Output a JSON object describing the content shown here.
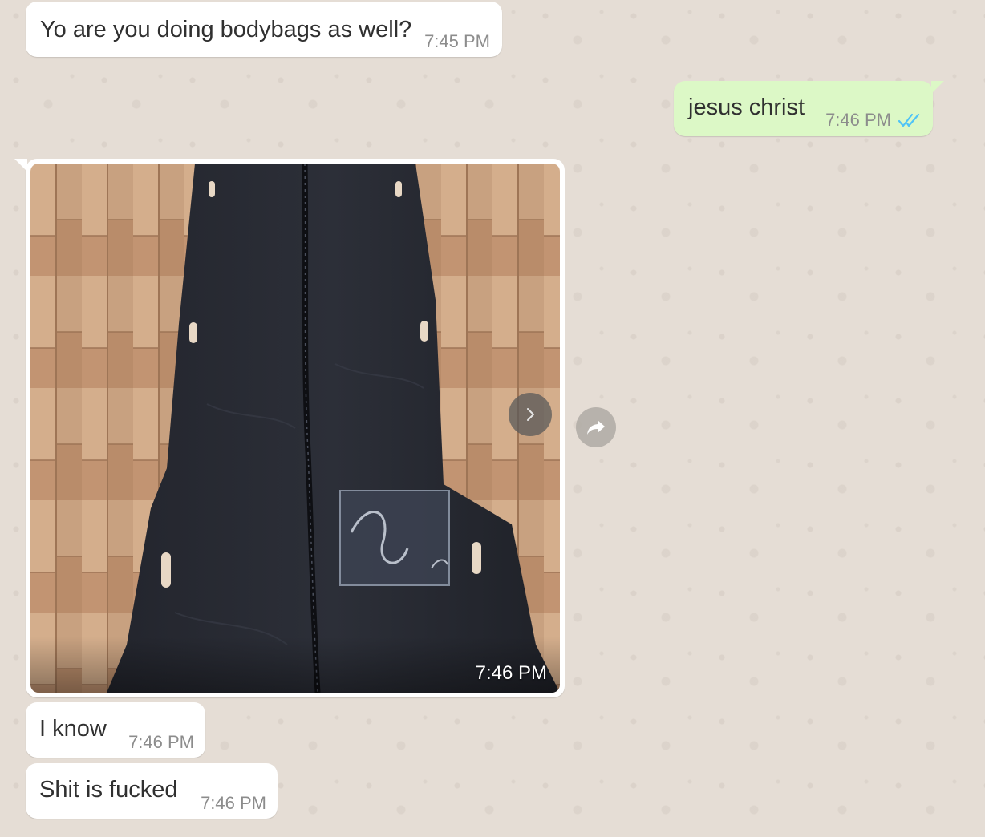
{
  "chat": {
    "messages": [
      {
        "direction": "incoming",
        "type": "text",
        "text": "Yo are you doing bodybags as well?",
        "time": "7:45 PM"
      },
      {
        "direction": "outgoing",
        "type": "text",
        "text": "jesus christ",
        "time": "7:46 PM",
        "status": "read",
        "status_icon": "double-check-icon"
      },
      {
        "direction": "incoming",
        "type": "image",
        "image_icon": "photo-bodybag",
        "time": "7:46 PM"
      },
      {
        "direction": "incoming",
        "type": "text",
        "text": "I know",
        "time": "7:46 PM"
      },
      {
        "direction": "incoming",
        "type": "text",
        "text": "Shit is fucked",
        "time": "7:46 PM"
      }
    ]
  },
  "controls": {
    "next_icon": "chevron-right-icon",
    "forward_icon": "forward-icon"
  },
  "colors": {
    "wallpaper": "#e5ddd5",
    "incoming_bubble": "#ffffff",
    "outgoing_bubble": "#dcf8c6",
    "read_ticks": "#4fc3f7",
    "timestamp": "#8c8c8c"
  }
}
